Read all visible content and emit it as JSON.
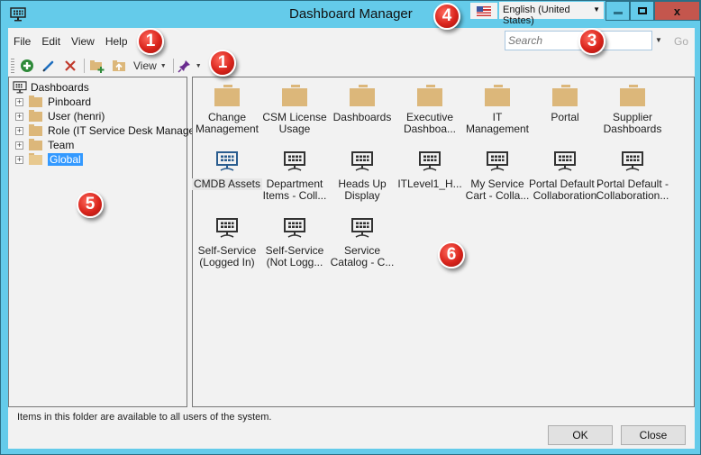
{
  "window": {
    "title": "Dashboard Manager",
    "language": "English (United States)",
    "close_glyph": "x"
  },
  "menu": [
    "File",
    "Edit",
    "View",
    "Help"
  ],
  "search": {
    "placeholder": "Search",
    "value": "",
    "go_label": "Go"
  },
  "toolbar": {
    "view_label": "View",
    "icons": [
      "add-icon",
      "edit-icon",
      "delete-icon",
      "new-folder-icon",
      "move-up-folder-icon",
      "pin-icon"
    ]
  },
  "tree": {
    "root": "Dashboards",
    "nodes": [
      {
        "label": "Pinboard",
        "selected": false
      },
      {
        "label": "User (henri)",
        "selected": false
      },
      {
        "label": "Role (IT Service Desk Manager)",
        "selected": false
      },
      {
        "label": "Team",
        "selected": false
      },
      {
        "label": "Global",
        "selected": true
      }
    ]
  },
  "items": {
    "folders": [
      {
        "line1": "Change",
        "line2": "Management"
      },
      {
        "line1": "CSM License",
        "line2": "Usage"
      },
      {
        "line1": "Dashboards",
        "line2": ""
      },
      {
        "line1": "Executive",
        "line2": "Dashboa..."
      },
      {
        "line1": "IT",
        "line2": "Management"
      },
      {
        "line1": "Portal",
        "line2": ""
      },
      {
        "line1": "Supplier",
        "line2": "Dashboards"
      }
    ],
    "dashboards": [
      {
        "line1": "CMDB Assets",
        "line2": "",
        "selected": true
      },
      {
        "line1": "Department",
        "line2": "Items - Coll..."
      },
      {
        "line1": "Heads Up",
        "line2": "Display"
      },
      {
        "line1": "ITLevel1_H...",
        "line2": ""
      },
      {
        "line1": "My Service",
        "line2": "Cart - Colla..."
      },
      {
        "line1": "Portal Default -",
        "line2": "Collaboration"
      },
      {
        "line1": "Portal Default -",
        "line2": "Collaboration..."
      },
      {
        "line1": "Self-Service",
        "line2": "(Logged In)"
      },
      {
        "line1": "Self-Service",
        "line2": "(Not Logg..."
      },
      {
        "line1": "Service",
        "line2": "Catalog - C..."
      }
    ]
  },
  "status": "Items in this folder are available to all users of the system.",
  "buttons": {
    "ok": "OK",
    "close": "Close"
  },
  "callouts": [
    "1",
    "1",
    "3",
    "4",
    "5",
    "6"
  ],
  "colors": {
    "titlebar": "#64cbea",
    "close_button": "#c4564d",
    "selection": "#3399ff",
    "folder": "#dcb77a",
    "callout": "#d9241c"
  }
}
